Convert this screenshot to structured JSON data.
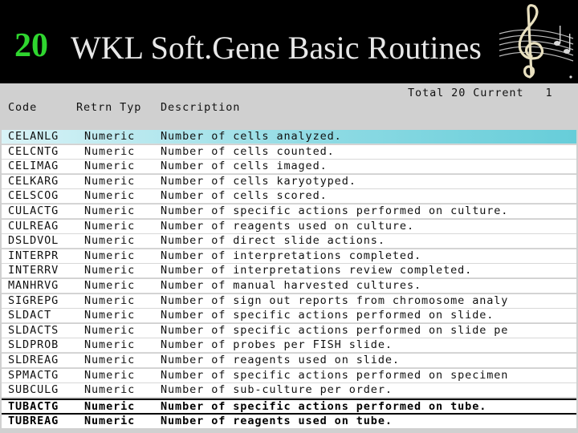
{
  "slide": {
    "number": "20",
    "title": "WKL Soft.Gene Basic Routines"
  },
  "panel": {
    "totals_label": "Total 20 Current   1",
    "headers": {
      "code": "Code",
      "retn_typ": "Retrn Typ",
      "description": "Description"
    }
  },
  "rows": [
    {
      "code": "CELANLG",
      "type": "Numeric",
      "desc": "Number of cells analyzed."
    },
    {
      "code": "CELCNTG",
      "type": "Numeric",
      "desc": "Number of cells counted."
    },
    {
      "code": "CELIMAG",
      "type": "Numeric",
      "desc": "Number of cells imaged."
    },
    {
      "code": "CELKARG",
      "type": "Numeric",
      "desc": "Number of cells karyotyped."
    },
    {
      "code": "CELSCOG",
      "type": "Numeric",
      "desc": "Number of cells scored."
    },
    {
      "code": "CULACTG",
      "type": "Numeric",
      "desc": "Number of specific actions performed on culture."
    },
    {
      "code": "CULREAG",
      "type": "Numeric",
      "desc": "Number of reagents used on culture."
    },
    {
      "code": "DSLDVOL",
      "type": "Numeric",
      "desc": "Number of direct slide actions."
    },
    {
      "code": "INTERPR",
      "type": "Numeric",
      "desc": "Number of interpretations completed."
    },
    {
      "code": "INTERRV",
      "type": "Numeric",
      "desc": "Number of interpretations review completed."
    },
    {
      "code": "MANHRVG",
      "type": "Numeric",
      "desc": "Number of manual harvested cultures."
    },
    {
      "code": "SIGREPG",
      "type": "Numeric",
      "desc": "Number of sign out reports from chromosome analy"
    },
    {
      "code": "SLDACT",
      "type": "Numeric",
      "desc": "Number of specific actions performed on slide."
    },
    {
      "code": "SLDACTS",
      "type": "Numeric",
      "desc": "Number of specific actions performed on slide pe"
    },
    {
      "code": "SLDPROB",
      "type": "Numeric",
      "desc": "Number of probes per FISH slide."
    },
    {
      "code": "SLDREAG",
      "type": "Numeric",
      "desc": "Number of reagents used on slide."
    },
    {
      "code": "SPMACTG",
      "type": "Numeric",
      "desc": "Number of specific actions performed on specimen"
    },
    {
      "code": "SUBCULG",
      "type": "Numeric",
      "desc": "Number of sub-culture per order."
    },
    {
      "code": "TUBACTG",
      "type": "Numeric",
      "desc": "Number of specific actions performed on tube."
    },
    {
      "code": "TUBREAG",
      "type": "Numeric",
      "desc": "Number of reagents used on tube."
    }
  ],
  "selected_row_index": 0,
  "colors": {
    "slide_number": "#2fd62f",
    "title_text": "#e8e8e8",
    "panel_bg": "#d0d0d0",
    "selection": "#66cdd9"
  },
  "icons": {
    "logo": "treble-clef-music-icon"
  }
}
